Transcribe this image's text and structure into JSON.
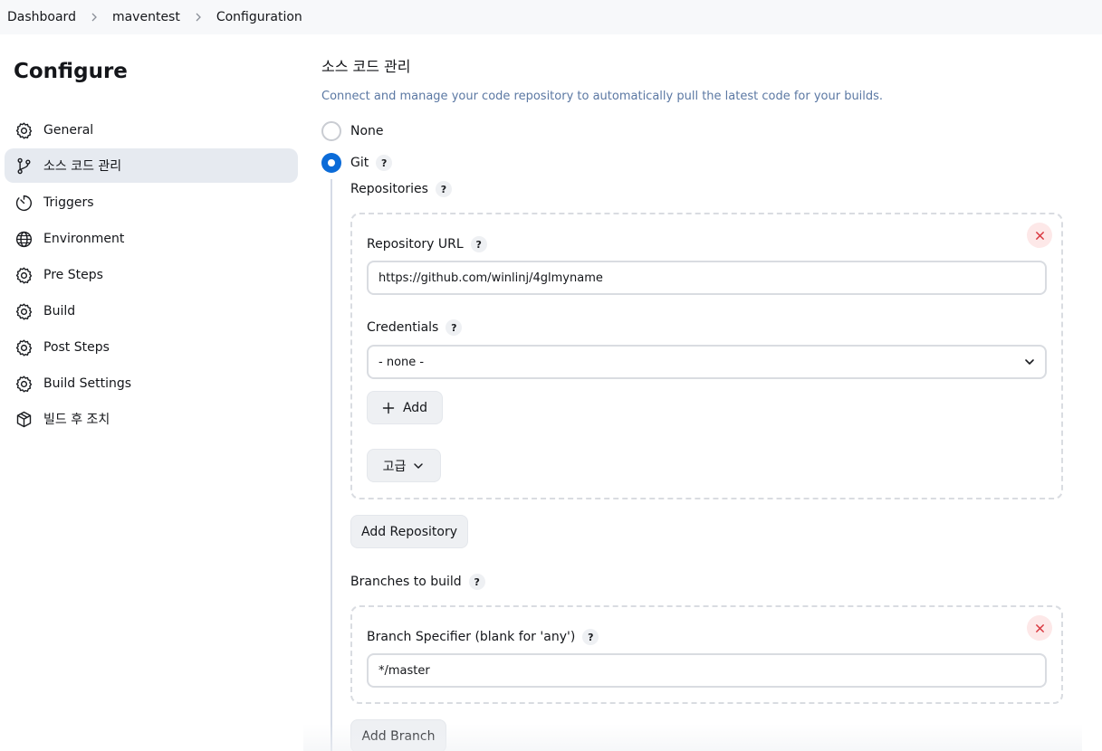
{
  "breadcrumb": {
    "items": [
      "Dashboard",
      "maventest",
      "Configuration"
    ]
  },
  "sidebar": {
    "title": "Configure",
    "items": [
      {
        "label": "General",
        "icon": "gear-icon"
      },
      {
        "label": "소스 코드 관리",
        "icon": "branch-icon",
        "active": true
      },
      {
        "label": "Triggers",
        "icon": "timer-icon"
      },
      {
        "label": "Environment",
        "icon": "globe-icon"
      },
      {
        "label": "Pre Steps",
        "icon": "gear-icon"
      },
      {
        "label": "Build",
        "icon": "gear-icon"
      },
      {
        "label": "Post Steps",
        "icon": "gear-icon"
      },
      {
        "label": "Build Settings",
        "icon": "gear-icon"
      },
      {
        "label": "빌드 후 조치",
        "icon": "package-icon"
      }
    ]
  },
  "scm": {
    "title": "소스 코드 관리",
    "description": "Connect and manage your code repository to automatically pull the latest code for your builds.",
    "options": [
      {
        "label": "None",
        "selected": false
      },
      {
        "label": "Git",
        "selected": true
      }
    ],
    "help_mark": "?",
    "repositories_label": "Repositories",
    "repository_url_label": "Repository URL",
    "repository_url_value": "https://github.com/winlinj/4glmyname",
    "credentials_label": "Credentials",
    "credentials_value": "- none -",
    "add_label": "Add",
    "advanced_label": "고급",
    "add_repository_label": "Add Repository",
    "branches_label": "Branches to build",
    "branch_specifier_label": "Branch Specifier (blank for 'any')",
    "branch_specifier_value": "*/master",
    "add_branch_label": "Add Branch"
  },
  "colors": {
    "accent": "#0b6bd8",
    "active_bg": "#e6eaf0",
    "description": "#5b78a3",
    "danger": "#d9363e"
  }
}
